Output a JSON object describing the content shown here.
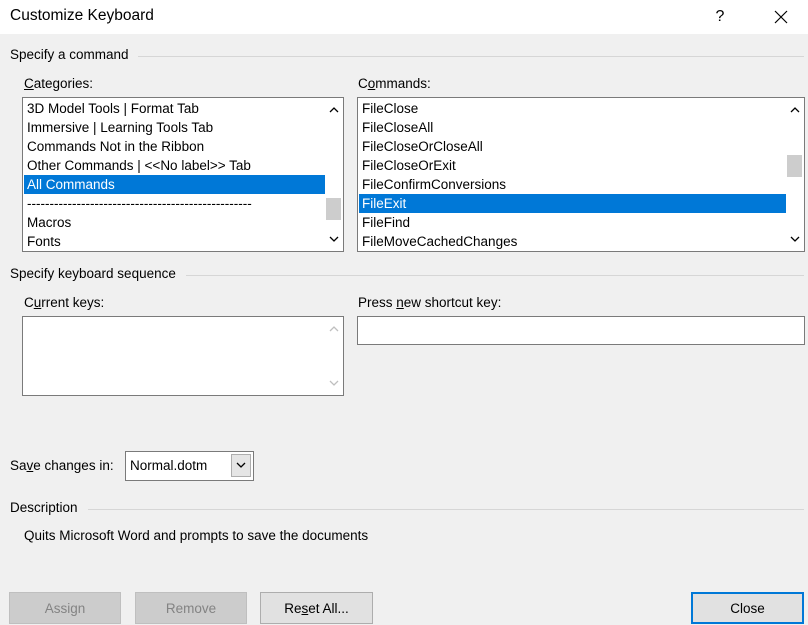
{
  "dialog": {
    "title": "Customize Keyboard",
    "help_glyph": "?",
    "close_icon": "close-x-icon"
  },
  "specify_command": {
    "section_label": "Specify a command",
    "categories": {
      "label_prefix": "",
      "label_accel": "C",
      "label_rest": "ategories:",
      "items": [
        "3D Model Tools | Format Tab",
        "Immersive | Learning Tools Tab",
        "Commands Not in the Ribbon",
        "Other Commands | <<No label>> Tab",
        "All Commands",
        "--------------------------------------------------",
        "Macros",
        "Fonts"
      ],
      "selected": "All Commands"
    },
    "commands": {
      "label_prefix": "C",
      "label_accel": "o",
      "label_rest": "mmands:",
      "items": [
        "FileClose",
        "FileCloseAll",
        "FileCloseOrCloseAll",
        "FileCloseOrExit",
        "FileConfirmConversions",
        "FileExit",
        "FileFind",
        "FileMoveCachedChanges"
      ],
      "selected": "FileExit"
    }
  },
  "keyboard_sequence": {
    "section_label": "Specify keyboard sequence",
    "current_keys": {
      "label_prefix": "C",
      "label_accel": "u",
      "label_rest": "rrent keys:"
    },
    "new_shortcut": {
      "label_prefix": "Press ",
      "label_accel": "n",
      "label_rest": "ew shortcut key:",
      "value": ""
    }
  },
  "save_changes": {
    "label_prefix": "Sa",
    "label_accel": "v",
    "label_rest": "e changes in:",
    "value": "Normal.dotm"
  },
  "description": {
    "section_label": "Description",
    "text": "Quits Microsoft Word and prompts to save the documents"
  },
  "buttons": {
    "assign": "Assign",
    "remove": "Remove",
    "reset_prefix": "Re",
    "reset_accel": "s",
    "reset_rest": "et All...",
    "close": "Close"
  },
  "colors": {
    "selection": "#0078d7",
    "dialog_bg": "#f0f0f0"
  }
}
